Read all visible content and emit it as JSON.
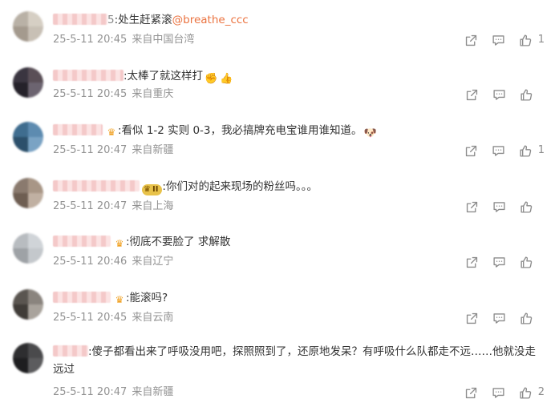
{
  "comments": [
    {
      "avatar": [
        "#b9b1a6",
        "#d6cfc4",
        "#a49a8e",
        "#c8c0b5"
      ],
      "user_tail": "5",
      "badge": "",
      "text": ":处生赶紧滚",
      "mention": "@breathe_ccc",
      "emojis": [],
      "date": "25-5-11 20:45",
      "location": "来自中国台湾",
      "likes": "1"
    },
    {
      "avatar": [
        "#3a3540",
        "#5a4f57",
        "#25222a",
        "#6c6470"
      ],
      "user_tail": "",
      "badge": "",
      "text": ":太棒了就这样打",
      "mention": "",
      "emojis": [
        {
          "icon": "punch-emoji",
          "glyph": "✊",
          "cls": "emoji-hit"
        },
        {
          "icon": "thumbs-up-emoji",
          "glyph": "👍",
          "cls": "emoji-thumb"
        }
      ],
      "date": "25-5-11 20:45",
      "location": "来自重庆",
      "likes": ""
    },
    {
      "avatar": [
        "#3f6d8f",
        "#5d8bb0",
        "#2c506b",
        "#7aa3c4"
      ],
      "user_tail": "",
      "badge": "crown",
      "text": ":看似 1-2 实则 0-3，我必搞牌充电宝谁用谁知道。",
      "mention": "",
      "emojis": [
        {
          "icon": "doge-emoji",
          "glyph": "🐶",
          "cls": "emoji-doge"
        }
      ],
      "date": "25-5-11 20:47",
      "location": "来自新疆",
      "likes": "1"
    },
    {
      "avatar": [
        "#8a7a6e",
        "#a89686",
        "#6e5e52",
        "#c0b0a2"
      ],
      "user_tail": "",
      "badge": "vip",
      "vip_text": "II",
      "text": ":你们对的起来现场的粉丝吗。。。",
      "mention": "",
      "emojis": [],
      "date": "25-5-11 20:47",
      "location": "来自上海",
      "likes": ""
    },
    {
      "avatar": [
        "#b8bcc0",
        "#d0d4d8",
        "#9ea2a6",
        "#c4c8cc"
      ],
      "user_tail": "",
      "badge": "crown",
      "text": ":彻底不要脸了 求解散",
      "mention": "",
      "emojis": [],
      "date": "25-5-11 20:46",
      "location": "来自辽宁",
      "likes": ""
    },
    {
      "avatar": [
        "#5a5550",
        "#8a847e",
        "#403c38",
        "#a9a39c"
      ],
      "user_tail": "",
      "badge": "crown",
      "text": ":能滚吗?",
      "mention": "",
      "emojis": [],
      "date": "25-5-11 20:45",
      "location": "来自云南",
      "likes": ""
    },
    {
      "avatar": [
        "#2e2e30",
        "#4a4a4c",
        "#1e1e20",
        "#5c5c5e"
      ],
      "user_tail": "",
      "badge": "",
      "text": ":傻子都看出来了呼吸没用吧，探照照到了，还原地发呆？有呼吸什么队都走不远……他就没走远过",
      "mention": "",
      "emojis": [],
      "date": "25-5-11 20:47",
      "location": "来自新疆",
      "likes": "2"
    }
  ],
  "icons": {
    "share": "share-icon",
    "comment": "comment-icon",
    "like": "thumbs-up-icon",
    "crown": "crown-badge-icon",
    "vip": "vip-badge-icon"
  },
  "colors": {
    "text": "#333333",
    "meta": "#939393",
    "mention": "#eb7340",
    "icon": "#8c8c8c"
  }
}
